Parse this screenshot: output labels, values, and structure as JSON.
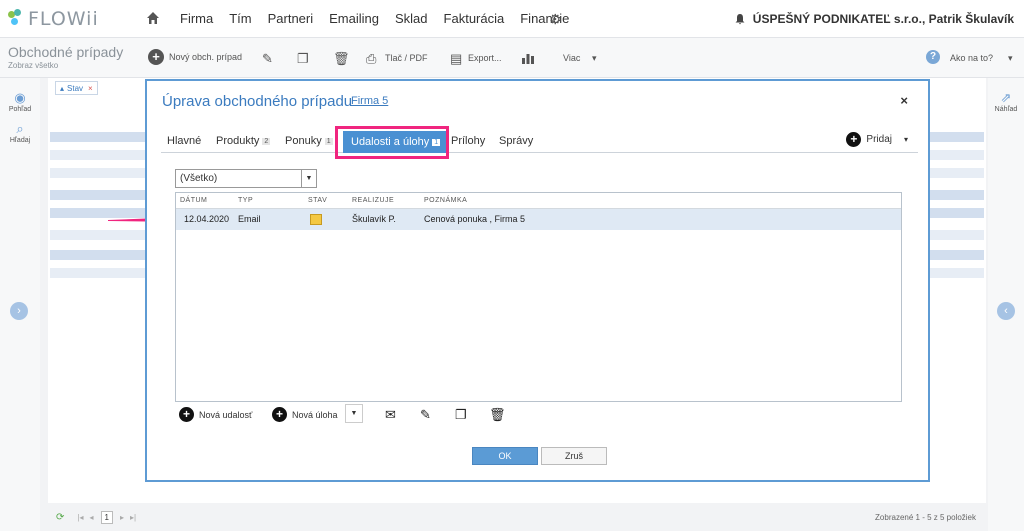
{
  "app": {
    "logo_text": "FLOWii"
  },
  "nav": {
    "items": [
      "Firma",
      "Tím",
      "Partneri",
      "Emailing",
      "Sklad",
      "Fakturácia",
      "Financie"
    ],
    "user": "ÚSPEŠNÝ PODNIKATEĽ s.r.o., Patrik Škulavík"
  },
  "toolbar": {
    "page_title": "Obchodné prípady",
    "page_sub": "Zobraz všetko",
    "new_label": "Nový obch. prípad",
    "print_label": "Tlač / PDF",
    "export_label": "Export...",
    "more_label": "Viac",
    "help_label": "Ako na to?"
  },
  "side": {
    "view_label": "Pohľad",
    "search_label": "Hľadaj",
    "preview_label": "Náhľad"
  },
  "list": {
    "filter_chip": "Stav",
    "count_text": "Zobrazené 1 - 5 z 5 položiek",
    "page": "1"
  },
  "modal": {
    "title": "Úprava obchodného prípadu",
    "link": "Firma 5",
    "tabs": [
      {
        "label": "Hlavné",
        "badge": ""
      },
      {
        "label": "Produkty",
        "badge": "2"
      },
      {
        "label": "Ponuky",
        "badge": "1"
      },
      {
        "label": "Udalosti a úlohy",
        "badge": "1"
      },
      {
        "label": "Prílohy",
        "badge": ""
      },
      {
        "label": "Správy",
        "badge": ""
      }
    ],
    "add_label": "Pridaj",
    "filter_value": "(Všetko)",
    "columns": [
      "DÁTUM",
      "TYP",
      "STAV",
      "REALIZUJE",
      "POZNÁMKA"
    ],
    "rows": [
      {
        "date": "12.04.2020",
        "type": "Email",
        "assignee": "Škulavík P.",
        "note": "Cenová ponuka , Firma 5"
      }
    ],
    "new_event": "Nová udalosť",
    "new_task": "Nová úloha",
    "ok": "OK",
    "cancel": "Zruš"
  },
  "colors": {
    "accent": "#4a90d2",
    "highlight": "#f0257f"
  }
}
